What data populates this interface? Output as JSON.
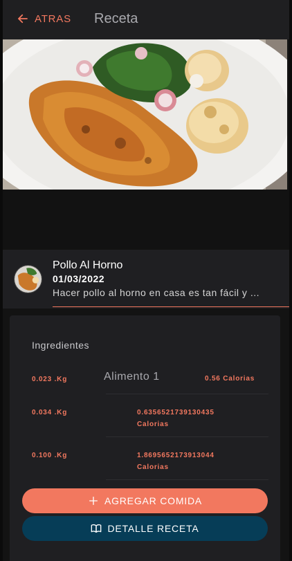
{
  "header": {
    "back_label": "ATRAS",
    "title": "Receta"
  },
  "recipe": {
    "title": "Pollo Al Horno",
    "date": "01/03/2022",
    "description": "Hacer pollo al horno en casa es tan fácil y ..."
  },
  "ingredients": {
    "section_title": "Ingredientes",
    "items": [
      {
        "quantity": "0.023 .Kg",
        "food": "Alimento 1",
        "calories": "0.56 Calorias"
      },
      {
        "quantity": "0.034 .Kg",
        "food": "",
        "calories_value": "0.6356521739130435",
        "calories_unit": "Calorias"
      },
      {
        "quantity": "0.100 .Kg",
        "food": "",
        "calories_value": "1.8695652173913044",
        "calories_unit": "Calorias"
      }
    ]
  },
  "actions": {
    "add_label": "AGREGAR COMIDA",
    "detail_label": "DETALLE RECETA"
  },
  "colors": {
    "accent": "#f2785f",
    "detail_button": "#063d57",
    "surface": "#1f1f22"
  },
  "icons": {
    "back": "arrow-left-icon",
    "add": "plus-icon",
    "detail": "book-open-icon"
  }
}
